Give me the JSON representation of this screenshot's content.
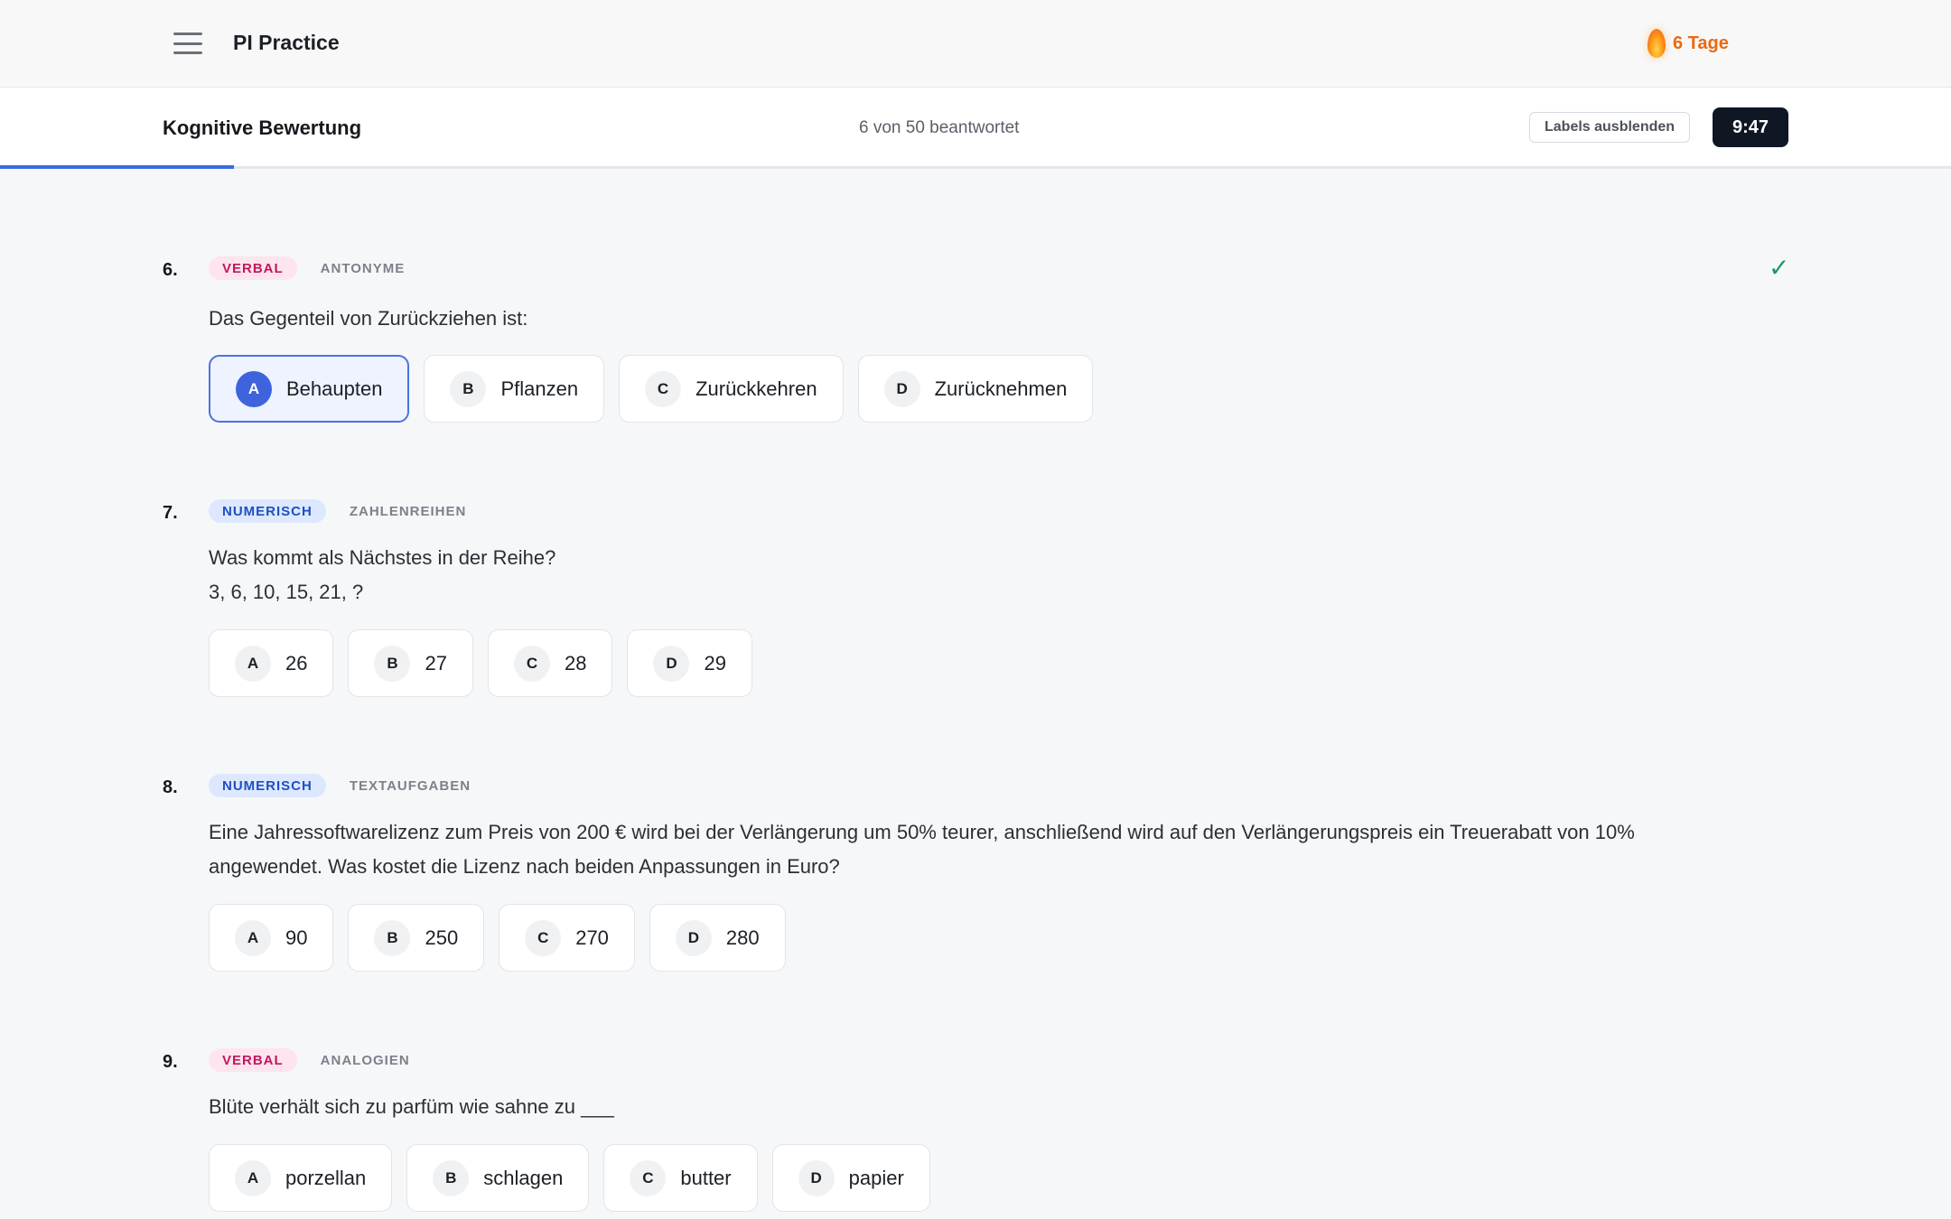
{
  "app": {
    "title": "PI Practice",
    "streak": "6 Tage"
  },
  "quiz": {
    "title": "Kognitive Bewertung",
    "answered": "6 von 50 beantwortet",
    "labels_button": "Labels ausblenden",
    "timer": "9:47",
    "progress_fraction": 0.12
  },
  "colors": {
    "accent": "#3a6be0",
    "verbal_bg": "#fde4ef",
    "verbal_fg": "#c2185b",
    "numeric_bg": "#dde8ff",
    "numeric_fg": "#1d4fc4",
    "streak": "#ea6a10",
    "check": "#1e9a62",
    "timer_bg": "#0f1624"
  },
  "questions": [
    {
      "number": "6.",
      "category": "VERBAL",
      "subcategory": "ANTONYME",
      "text": "Das Gegenteil von Zurückziehen ist:",
      "answered": true,
      "check_icon": "✓",
      "options": [
        {
          "letter": "A",
          "text": "Behaupten",
          "selected": true
        },
        {
          "letter": "B",
          "text": "Pflanzen",
          "selected": false
        },
        {
          "letter": "C",
          "text": "Zurückkehren",
          "selected": false
        },
        {
          "letter": "D",
          "text": "Zurücknehmen",
          "selected": false
        }
      ]
    },
    {
      "number": "7.",
      "category": "NUMERISCH",
      "subcategory": "ZAHLENREIHEN",
      "text": "Was kommt als Nächstes in der Reihe?",
      "text2": "3, 6, 10, 15, 21, ?",
      "options": [
        {
          "letter": "A",
          "text": "26"
        },
        {
          "letter": "B",
          "text": "27"
        },
        {
          "letter": "C",
          "text": "28"
        },
        {
          "letter": "D",
          "text": "29"
        }
      ]
    },
    {
      "number": "8.",
      "category": "NUMERISCH",
      "subcategory": "TEXTAUFGABEN",
      "text": "Eine Jahressoftwarelizenz zum Preis von 200 € wird bei der Verlängerung um 50% teurer, anschließend wird auf den Verlängerungspreis ein Treuerabatt von 10% angewendet. Was kostet die Lizenz nach beiden Anpassungen in Euro?",
      "options": [
        {
          "letter": "A",
          "text": "90"
        },
        {
          "letter": "B",
          "text": "250"
        },
        {
          "letter": "C",
          "text": "270"
        },
        {
          "letter": "D",
          "text": "280"
        }
      ]
    },
    {
      "number": "9.",
      "category": "VERBAL",
      "subcategory": "ANALOGIEN",
      "text": "Blüte verhält sich zu parfüm wie sahne zu ___",
      "options": [
        {
          "letter": "A",
          "text": "porzellan"
        },
        {
          "letter": "B",
          "text": "schlagen"
        },
        {
          "letter": "C",
          "text": "butter"
        },
        {
          "letter": "D",
          "text": "papier"
        }
      ]
    }
  ]
}
